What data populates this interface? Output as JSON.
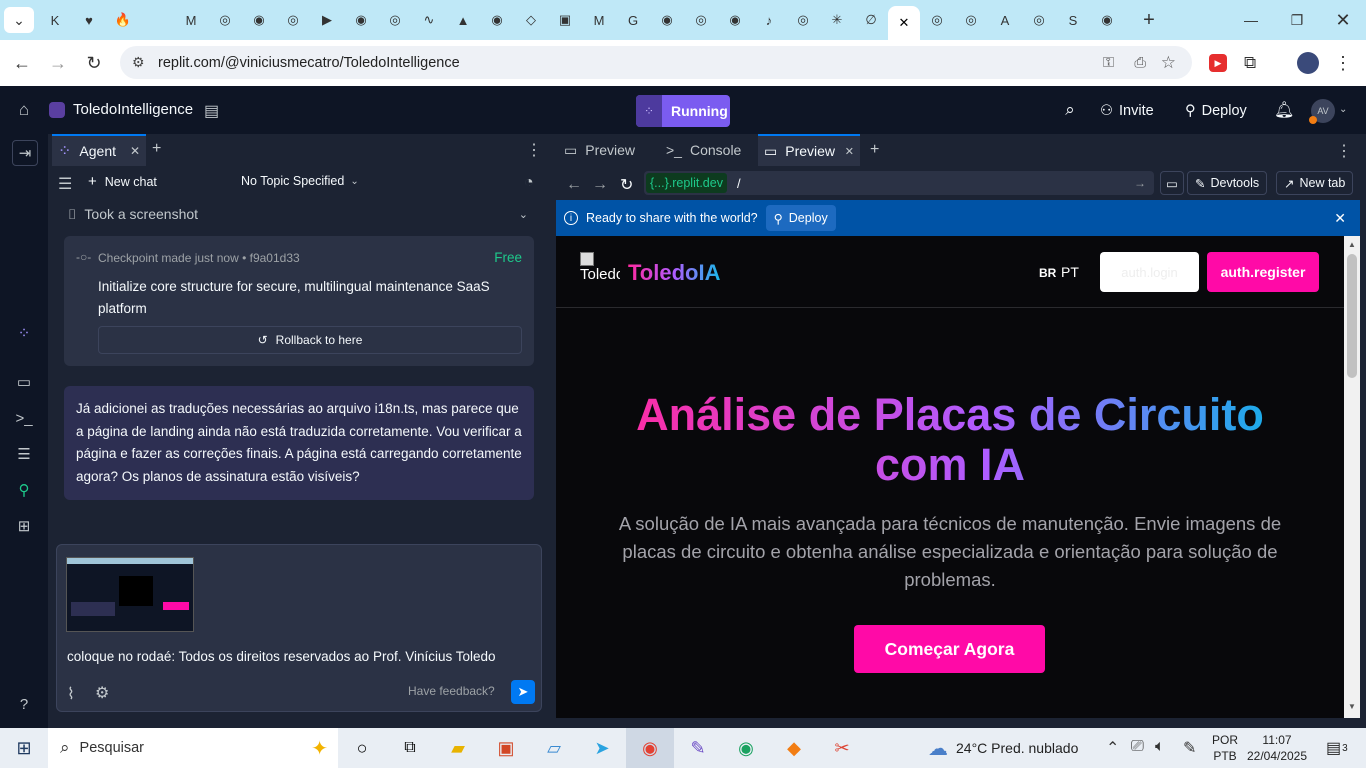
{
  "browser": {
    "tabs": [
      "K",
      "♥",
      "🔥",
      "",
      "M",
      "◎",
      "◉",
      "◎",
      "▶",
      "◉",
      "◎",
      "∿",
      "▲",
      "◉",
      "◇",
      "▣",
      "M",
      "G",
      "◉",
      "◎",
      "◉",
      "♪",
      "◎",
      "✳",
      "∅",
      "",
      "◎",
      "◎",
      "A",
      "◎",
      "S",
      "◉"
    ],
    "url": "replit.com/@viniciusmecatro/ToledoIntelligence"
  },
  "replit": {
    "project_name": "ToledoIntelligence",
    "status": "Running",
    "invite_label": "Invite",
    "deploy_label": "Deploy",
    "avatar": "AV"
  },
  "agent_panel": {
    "tab_label": "Agent",
    "new_chat": "New chat",
    "topic": "No Topic Specified",
    "screenshot_note": "Took a screenshot",
    "checkpoint": {
      "meta": "Checkpoint made just now • f9a01d33",
      "badge": "Free",
      "title": "Initialize core structure for secure, multilingual maintenance SaaS platform",
      "rollback": "Rollback to here"
    },
    "message": "Já adicionei as traduções necessárias ao arquivo i18n.ts, mas parece que a página de landing ainda não está traduzida corretamente. Vou verificar a página e fazer as correções finais. A página está carregando corretamente agora? Os planos de assinatura estão visíveis?",
    "input_text": "coloque no rodaé: Todos os direitos reservados ao Prof. Vinícius Toledo",
    "feedback": "Have feedback?"
  },
  "right_panel": {
    "tabs": [
      "Preview",
      "Console",
      "Preview"
    ],
    "domain": "{...}.replit.dev",
    "path": "/",
    "devtools": "Devtools",
    "new_tab": "New tab",
    "banner_text": "Ready to share with the world?",
    "banner_btn": "Deploy"
  },
  "site": {
    "logo_alt": "Toledo",
    "brand": "ToledoIA",
    "lang_flag": "BR",
    "lang": "PT",
    "login": "auth.login",
    "register": "auth.register",
    "hero_title": "Análise de Placas de Circuito com IA",
    "hero_sub": "A solução de IA mais avançada para técnicos de manutenção. Envie imagens de placas de circuito e obtenha análise especializada e orientação para solução de problemas.",
    "cta": "Começar Agora"
  },
  "taskbar": {
    "search": "Pesquisar",
    "weather": "24°C  Pred. nublado",
    "lang1": "POR",
    "lang2": "PTB",
    "time": "11:07",
    "date": "22/04/2025",
    "notif": "3"
  },
  "colors": {
    "accent_pink": "#ff0aa7",
    "running_purple": "#7b5cf0",
    "banner_blue": "#0053a6",
    "replit_bg": "#0e1525"
  }
}
